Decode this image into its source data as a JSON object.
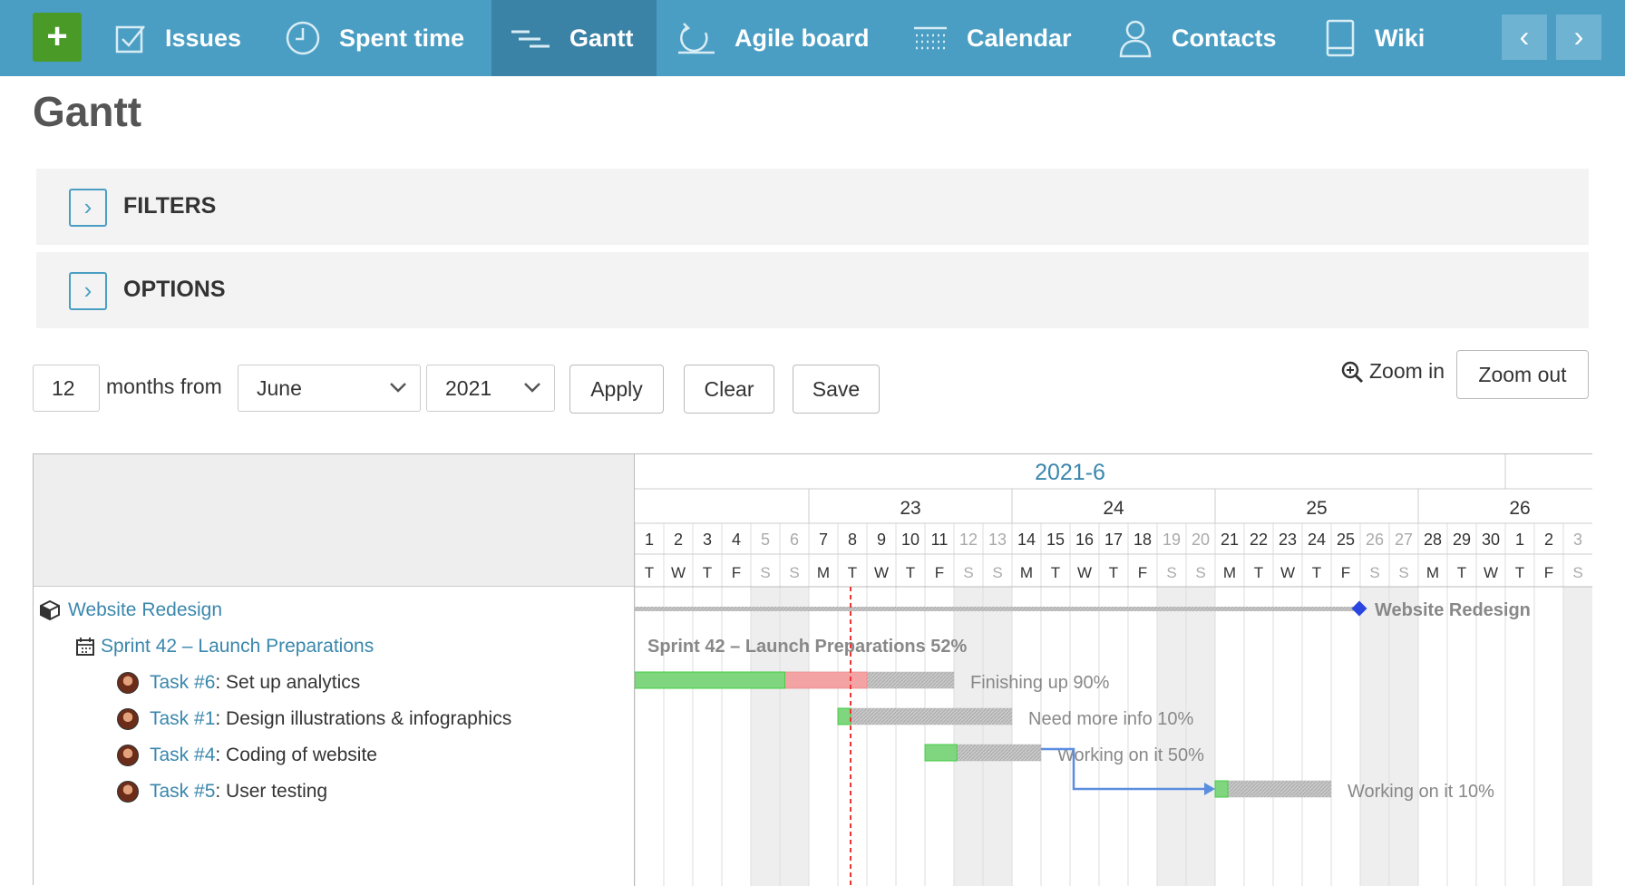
{
  "topbar": {
    "new_label": "+",
    "items": [
      {
        "label": "Issues",
        "icon": "checkbox-icon"
      },
      {
        "label": "Spent time",
        "icon": "clock-icon"
      },
      {
        "label": "Gantt",
        "icon": "gantt-icon"
      },
      {
        "label": "Agile board",
        "icon": "agile-icon"
      },
      {
        "label": "Calendar",
        "icon": "calendar-icon"
      },
      {
        "label": "Contacts",
        "icon": "person-icon"
      },
      {
        "label": "Wiki",
        "icon": "book-icon"
      }
    ],
    "prev": "‹",
    "next": "›",
    "colors": {
      "bar": "#4a9ec3",
      "active": "#3a82a6",
      "new": "#4a9a27"
    }
  },
  "page_title": "Gantt",
  "filters_label": "FILTERS",
  "options_label": "OPTIONS",
  "controls": {
    "months_value": "12",
    "months_from": "months from",
    "month_selected": "June",
    "year_selected": "2021",
    "apply": "Apply",
    "clear": "Clear",
    "save": "Save",
    "zoom_in": "Zoom in",
    "zoom_out": "Zoom out"
  },
  "gantt": {
    "month_label": "2021-6",
    "weeks": [
      "23",
      "24",
      "25",
      "26"
    ],
    "days": [
      "1",
      "2",
      "3",
      "4",
      "5",
      "6",
      "7",
      "8",
      "9",
      "10",
      "11",
      "12",
      "13",
      "14",
      "15",
      "16",
      "17",
      "18",
      "19",
      "20",
      "21",
      "22",
      "23",
      "24",
      "25",
      "26",
      "27",
      "28",
      "29",
      "30",
      "1",
      "2",
      "3"
    ],
    "weekdays": [
      "T",
      "W",
      "T",
      "F",
      "S",
      "S",
      "M",
      "T",
      "W",
      "T",
      "F",
      "S",
      "S",
      "M",
      "T",
      "W",
      "T",
      "F",
      "S",
      "S",
      "M",
      "T",
      "W",
      "T",
      "F",
      "S",
      "S",
      "M",
      "T",
      "W",
      "T",
      "F",
      "S"
    ],
    "rows": [
      {
        "kind": "project",
        "icon": "box-icon",
        "link": "Website Redesign",
        "rest": ""
      },
      {
        "kind": "version",
        "icon": "calendar-small-icon",
        "link": "Sprint 42 – Launch Preparations",
        "rest": ""
      },
      {
        "kind": "issue",
        "link": "Task #6",
        "rest": ": Set up analytics"
      },
      {
        "kind": "issue",
        "link": "Task #1",
        "rest": ": Design illustrations & infographics"
      },
      {
        "kind": "issue",
        "link": "Task #4",
        "rest": ": Coding of website"
      },
      {
        "kind": "issue",
        "link": "Task #5",
        "rest": ": User testing"
      }
    ],
    "bars": [
      {
        "kind": "project",
        "start": "2021-06-01",
        "end": "2021-06-25",
        "label": "Website Redesign"
      },
      {
        "kind": "version",
        "label": "Sprint 42 – Launch Preparations 52%"
      },
      {
        "kind": "issue",
        "start": "2021-06-01",
        "end": "2021-06-11",
        "done": 0.9,
        "late_until": "2021-06-08",
        "label": "Finishing up 90%"
      },
      {
        "kind": "issue",
        "start": "2021-06-08",
        "end": "2021-06-13",
        "done": 0.1,
        "label": "Need more info 10%"
      },
      {
        "kind": "issue",
        "start": "2021-06-11",
        "end": "2021-06-14",
        "done": 0.5,
        "label": "Working on it 50%"
      },
      {
        "kind": "issue",
        "start": "2021-06-21",
        "end": "2021-06-24",
        "done": 0.1,
        "label": "Working on it 10%"
      }
    ],
    "today": "2021-06-08",
    "relation": {
      "from_row": 4,
      "to_row": 5,
      "type": "precedes"
    },
    "colors": {
      "done": "#7fd67f",
      "late": "#f3a3a3",
      "todo": "#c8c8c8",
      "weekend": "#eeeeee",
      "today": "#e33",
      "relation": "#5b8de0",
      "milestone": "#2b45e0",
      "link": "#3a87ad"
    }
  }
}
